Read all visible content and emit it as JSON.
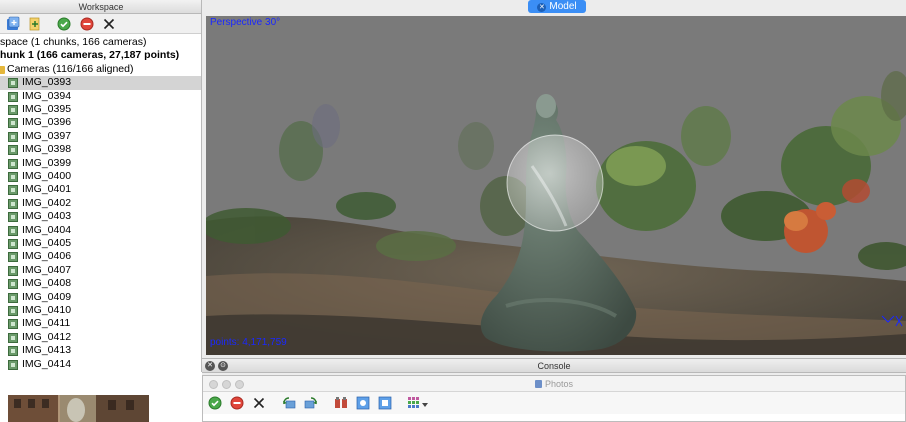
{
  "workspace": {
    "title": "Workspace",
    "tree": {
      "root": "space (1 chunks, 166 cameras)",
      "chunk": "hunk 1 (166 cameras, 27,187 points)",
      "cameras_folder": "Cameras (116/166 aligned)",
      "selected_index": 0,
      "cameras": [
        "IMG_0393",
        "IMG_0394",
        "IMG_0395",
        "IMG_0396",
        "IMG_0397",
        "IMG_0398",
        "IMG_0399",
        "IMG_0400",
        "IMG_0401",
        "IMG_0402",
        "IMG_0403",
        "IMG_0404",
        "IMG_0405",
        "IMG_0406",
        "IMG_0407",
        "IMG_0408",
        "IMG_0409",
        "IMG_0410",
        "IMG_0411",
        "IMG_0412",
        "IMG_0413",
        "IMG_0414"
      ]
    },
    "toolbar_icons": [
      "add-chunk-icon",
      "add-photos-icon",
      "enable-icon",
      "disable-icon",
      "remove-icon"
    ]
  },
  "model": {
    "tab_label": "Model",
    "perspective": "Perspective 30°",
    "points": "points: 4,171,759"
  },
  "console": {
    "label": "Console"
  },
  "photos": {
    "title": "Photos",
    "toolbar_icons": [
      "enable-icon",
      "disable-icon",
      "remove-icon",
      "rotate-left-icon",
      "rotate-right-icon",
      "reset-filter-icon",
      "filter-by-point-icon",
      "filter-by-marker-icon",
      "view-mode-icon"
    ]
  },
  "colors": {
    "accent": "#3b8ef5",
    "viewport_bg": "#7a7a7a",
    "overlay_text": "#1a28ff",
    "selection": "#d4d4d4"
  }
}
